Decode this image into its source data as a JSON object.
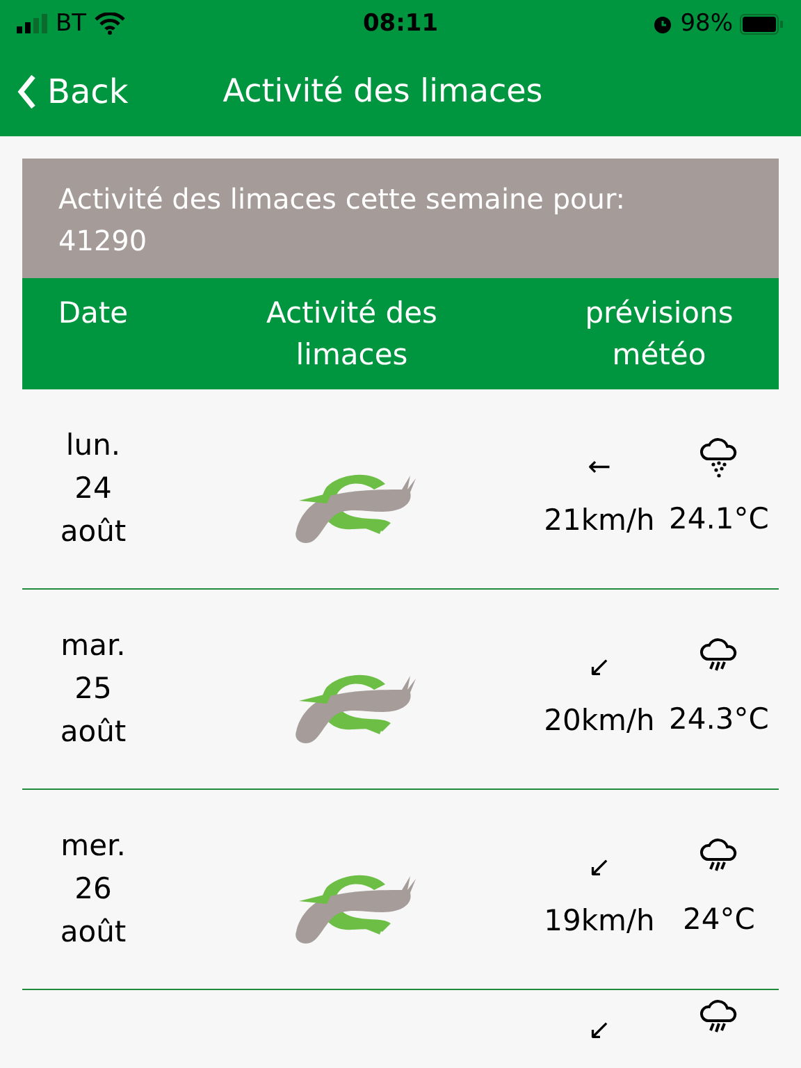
{
  "status_bar": {
    "carrier": "BT",
    "time": "08:11",
    "battery": "98%"
  },
  "nav": {
    "back": "Back",
    "title": "Activité des limaces"
  },
  "banner": {
    "text": "Activité des limaces cette semaine pour: 41290"
  },
  "table": {
    "columns": [
      "Date",
      "Activité des limaces",
      "prévisions météo"
    ],
    "rows": [
      {
        "date": [
          "lun.",
          "24",
          "août"
        ],
        "wind_arrow": "←",
        "wind": "21km/h",
        "weather": {
          "kind": "drizzle"
        },
        "temp": "24.1°C"
      },
      {
        "date": [
          "mar.",
          "25",
          "août"
        ],
        "wind_arrow": "↙",
        "wind": "20km/h",
        "weather": {
          "kind": "rain"
        },
        "temp": "24.3°C"
      },
      {
        "date": [
          "mer.",
          "26",
          "août"
        ],
        "wind_arrow": "↙",
        "wind": "19km/h",
        "weather": {
          "kind": "rain"
        },
        "temp": "24°C"
      },
      {
        "date": [],
        "wind_arrow": "↙",
        "weather": {
          "kind": "rain"
        }
      }
    ]
  }
}
